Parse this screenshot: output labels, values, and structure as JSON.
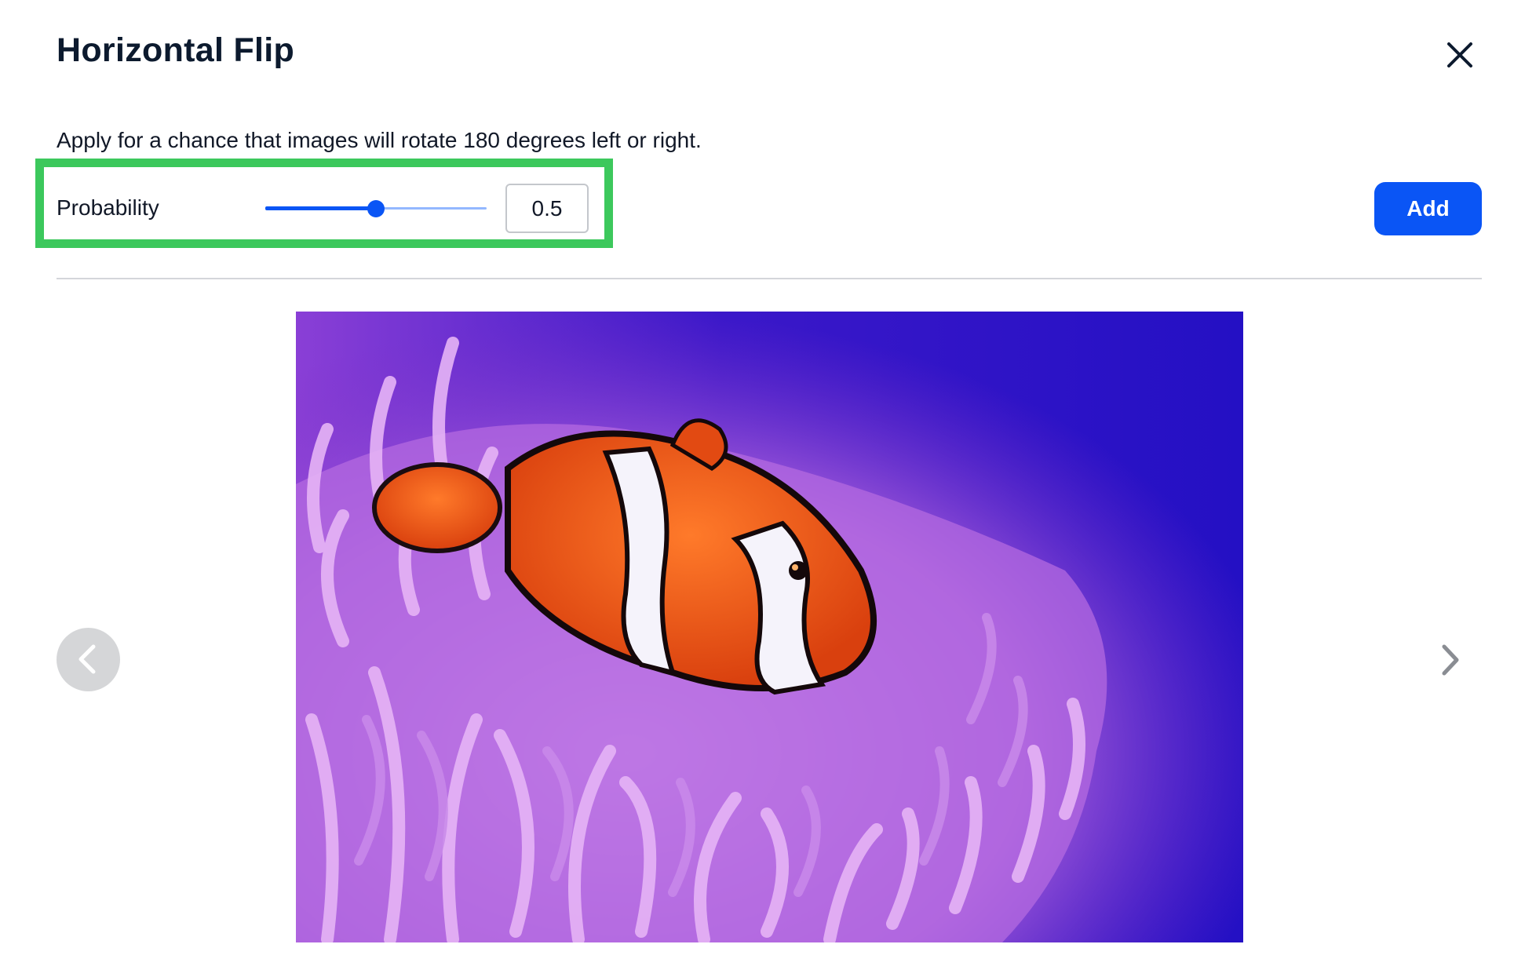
{
  "dialog": {
    "title": "Horizontal Flip",
    "close_icon": "close-icon"
  },
  "description": "Apply for a chance that images will rotate 180 degrees left or right.",
  "probability": {
    "label": "Probability",
    "value": "0.5",
    "slider_fraction": 0.5
  },
  "actions": {
    "add_label": "Add"
  },
  "preview": {
    "image_subject": "clownfish in purple sea anemone",
    "prev_icon": "chevron-left-icon",
    "next_icon": "chevron-right-icon"
  },
  "colors": {
    "accent": "#0a55f5",
    "highlight": "#3cc85c",
    "divider": "#d4d6da"
  }
}
